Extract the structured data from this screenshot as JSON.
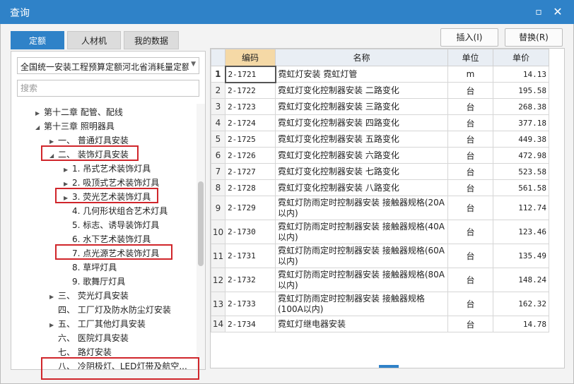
{
  "window": {
    "title": "查询",
    "maximize_icon": "maximize-icon",
    "close_icon": "close-icon"
  },
  "tabs": [
    "定额",
    "人材机",
    "我的数据"
  ],
  "buttons": {
    "insert": "插入(I)",
    "replace": "替换(R)"
  },
  "left": {
    "select_value": "全国统一安装工程预算定额河北省消耗量定额(",
    "search_placeholder": "搜索",
    "tree": [
      {
        "label": "第十二章 配管、配线",
        "indent": 0,
        "arrow": "▶"
      },
      {
        "label": "第十三章 照明器具",
        "indent": 0,
        "arrow": "◢"
      },
      {
        "label": "一、 普通灯具安装",
        "indent": 1,
        "arrow": "▶"
      },
      {
        "label": "二、 装饰灯具安装",
        "indent": 1,
        "arrow": "◢"
      },
      {
        "label": "1. 吊式艺术装饰灯具",
        "indent": 2,
        "arrow": "▶"
      },
      {
        "label": "2. 吸顶式艺术装饰灯具",
        "indent": 2,
        "arrow": "▶"
      },
      {
        "label": "3. 荧光艺术装饰灯具",
        "indent": 2,
        "arrow": "▶"
      },
      {
        "label": "4. 几何形状组合艺术灯具",
        "indent": 2,
        "arrow": ""
      },
      {
        "label": "5. 标志、诱导装饰灯具",
        "indent": 2,
        "arrow": ""
      },
      {
        "label": "6. 水下艺术装饰灯具",
        "indent": 2,
        "arrow": ""
      },
      {
        "label": "7. 点光源艺术装饰灯具",
        "indent": 2,
        "arrow": ""
      },
      {
        "label": "8. 草坪灯具",
        "indent": 2,
        "arrow": ""
      },
      {
        "label": "9. 歌舞厅灯具",
        "indent": 2,
        "arrow": ""
      },
      {
        "label": "三、 荧光灯具安装",
        "indent": 1,
        "arrow": "▶"
      },
      {
        "label": "四、 工厂灯及防水防尘灯安装",
        "indent": 1,
        "arrow": ""
      },
      {
        "label": "五、 工厂其他灯具安装",
        "indent": 1,
        "arrow": "▶"
      },
      {
        "label": "六、 医院灯具安装",
        "indent": 1,
        "arrow": ""
      },
      {
        "label": "七、 路灯安装",
        "indent": 1,
        "arrow": ""
      },
      {
        "label": "八、 冷阴极灯、LED灯带及航空...",
        "indent": 1,
        "arrow": ""
      }
    ]
  },
  "table": {
    "headers": {
      "num": "",
      "code": "编码",
      "name": "名称",
      "unit": "单位",
      "price": "单价"
    },
    "rows": [
      {
        "num": "1",
        "code": "2-1721",
        "name": "霓虹灯安装 霓虹灯管",
        "unit": "m",
        "price": "14.13"
      },
      {
        "num": "2",
        "code": "2-1722",
        "name": "霓虹灯变化控制器安装 二路变化",
        "unit": "台",
        "price": "195.58"
      },
      {
        "num": "3",
        "code": "2-1723",
        "name": "霓虹灯变化控制器安装 三路变化",
        "unit": "台",
        "price": "268.38"
      },
      {
        "num": "4",
        "code": "2-1724",
        "name": "霓虹灯变化控制器安装 四路变化",
        "unit": "台",
        "price": "377.18"
      },
      {
        "num": "5",
        "code": "2-1725",
        "name": "霓虹灯变化控制器安装 五路变化",
        "unit": "台",
        "price": "449.38"
      },
      {
        "num": "6",
        "code": "2-1726",
        "name": "霓虹灯变化控制器安装 六路变化",
        "unit": "台",
        "price": "472.98"
      },
      {
        "num": "7",
        "code": "2-1727",
        "name": "霓虹灯变化控制器安装 七路变化",
        "unit": "台",
        "price": "523.58"
      },
      {
        "num": "8",
        "code": "2-1728",
        "name": "霓虹灯变化控制器安装 八路变化",
        "unit": "台",
        "price": "561.58"
      },
      {
        "num": "9",
        "code": "2-1729",
        "name": "霓虹灯防雨定时控制器安装 接触器规格(20A以内)",
        "unit": "台",
        "price": "112.74"
      },
      {
        "num": "10",
        "code": "2-1730",
        "name": "霓虹灯防雨定时控制器安装 接触器规格(40A以内)",
        "unit": "台",
        "price": "123.46"
      },
      {
        "num": "11",
        "code": "2-1731",
        "name": "霓虹灯防雨定时控制器安装 接触器规格(60A以内)",
        "unit": "台",
        "price": "135.49"
      },
      {
        "num": "12",
        "code": "2-1732",
        "name": "霓虹灯防雨定时控制器安装 接触器规格(80A以内)",
        "unit": "台",
        "price": "148.24"
      },
      {
        "num": "13",
        "code": "2-1733",
        "name": "霓虹灯防雨定时控制器安装 接触器规格(100A以内)",
        "unit": "台",
        "price": "162.32"
      },
      {
        "num": "14",
        "code": "2-1734",
        "name": "霓虹灯继电器安装",
        "unit": "台",
        "price": "14.78"
      }
    ]
  },
  "colors": {
    "accent": "#2f82c8",
    "highlight": "#d0262b",
    "code_header": "#f5d9a6"
  }
}
